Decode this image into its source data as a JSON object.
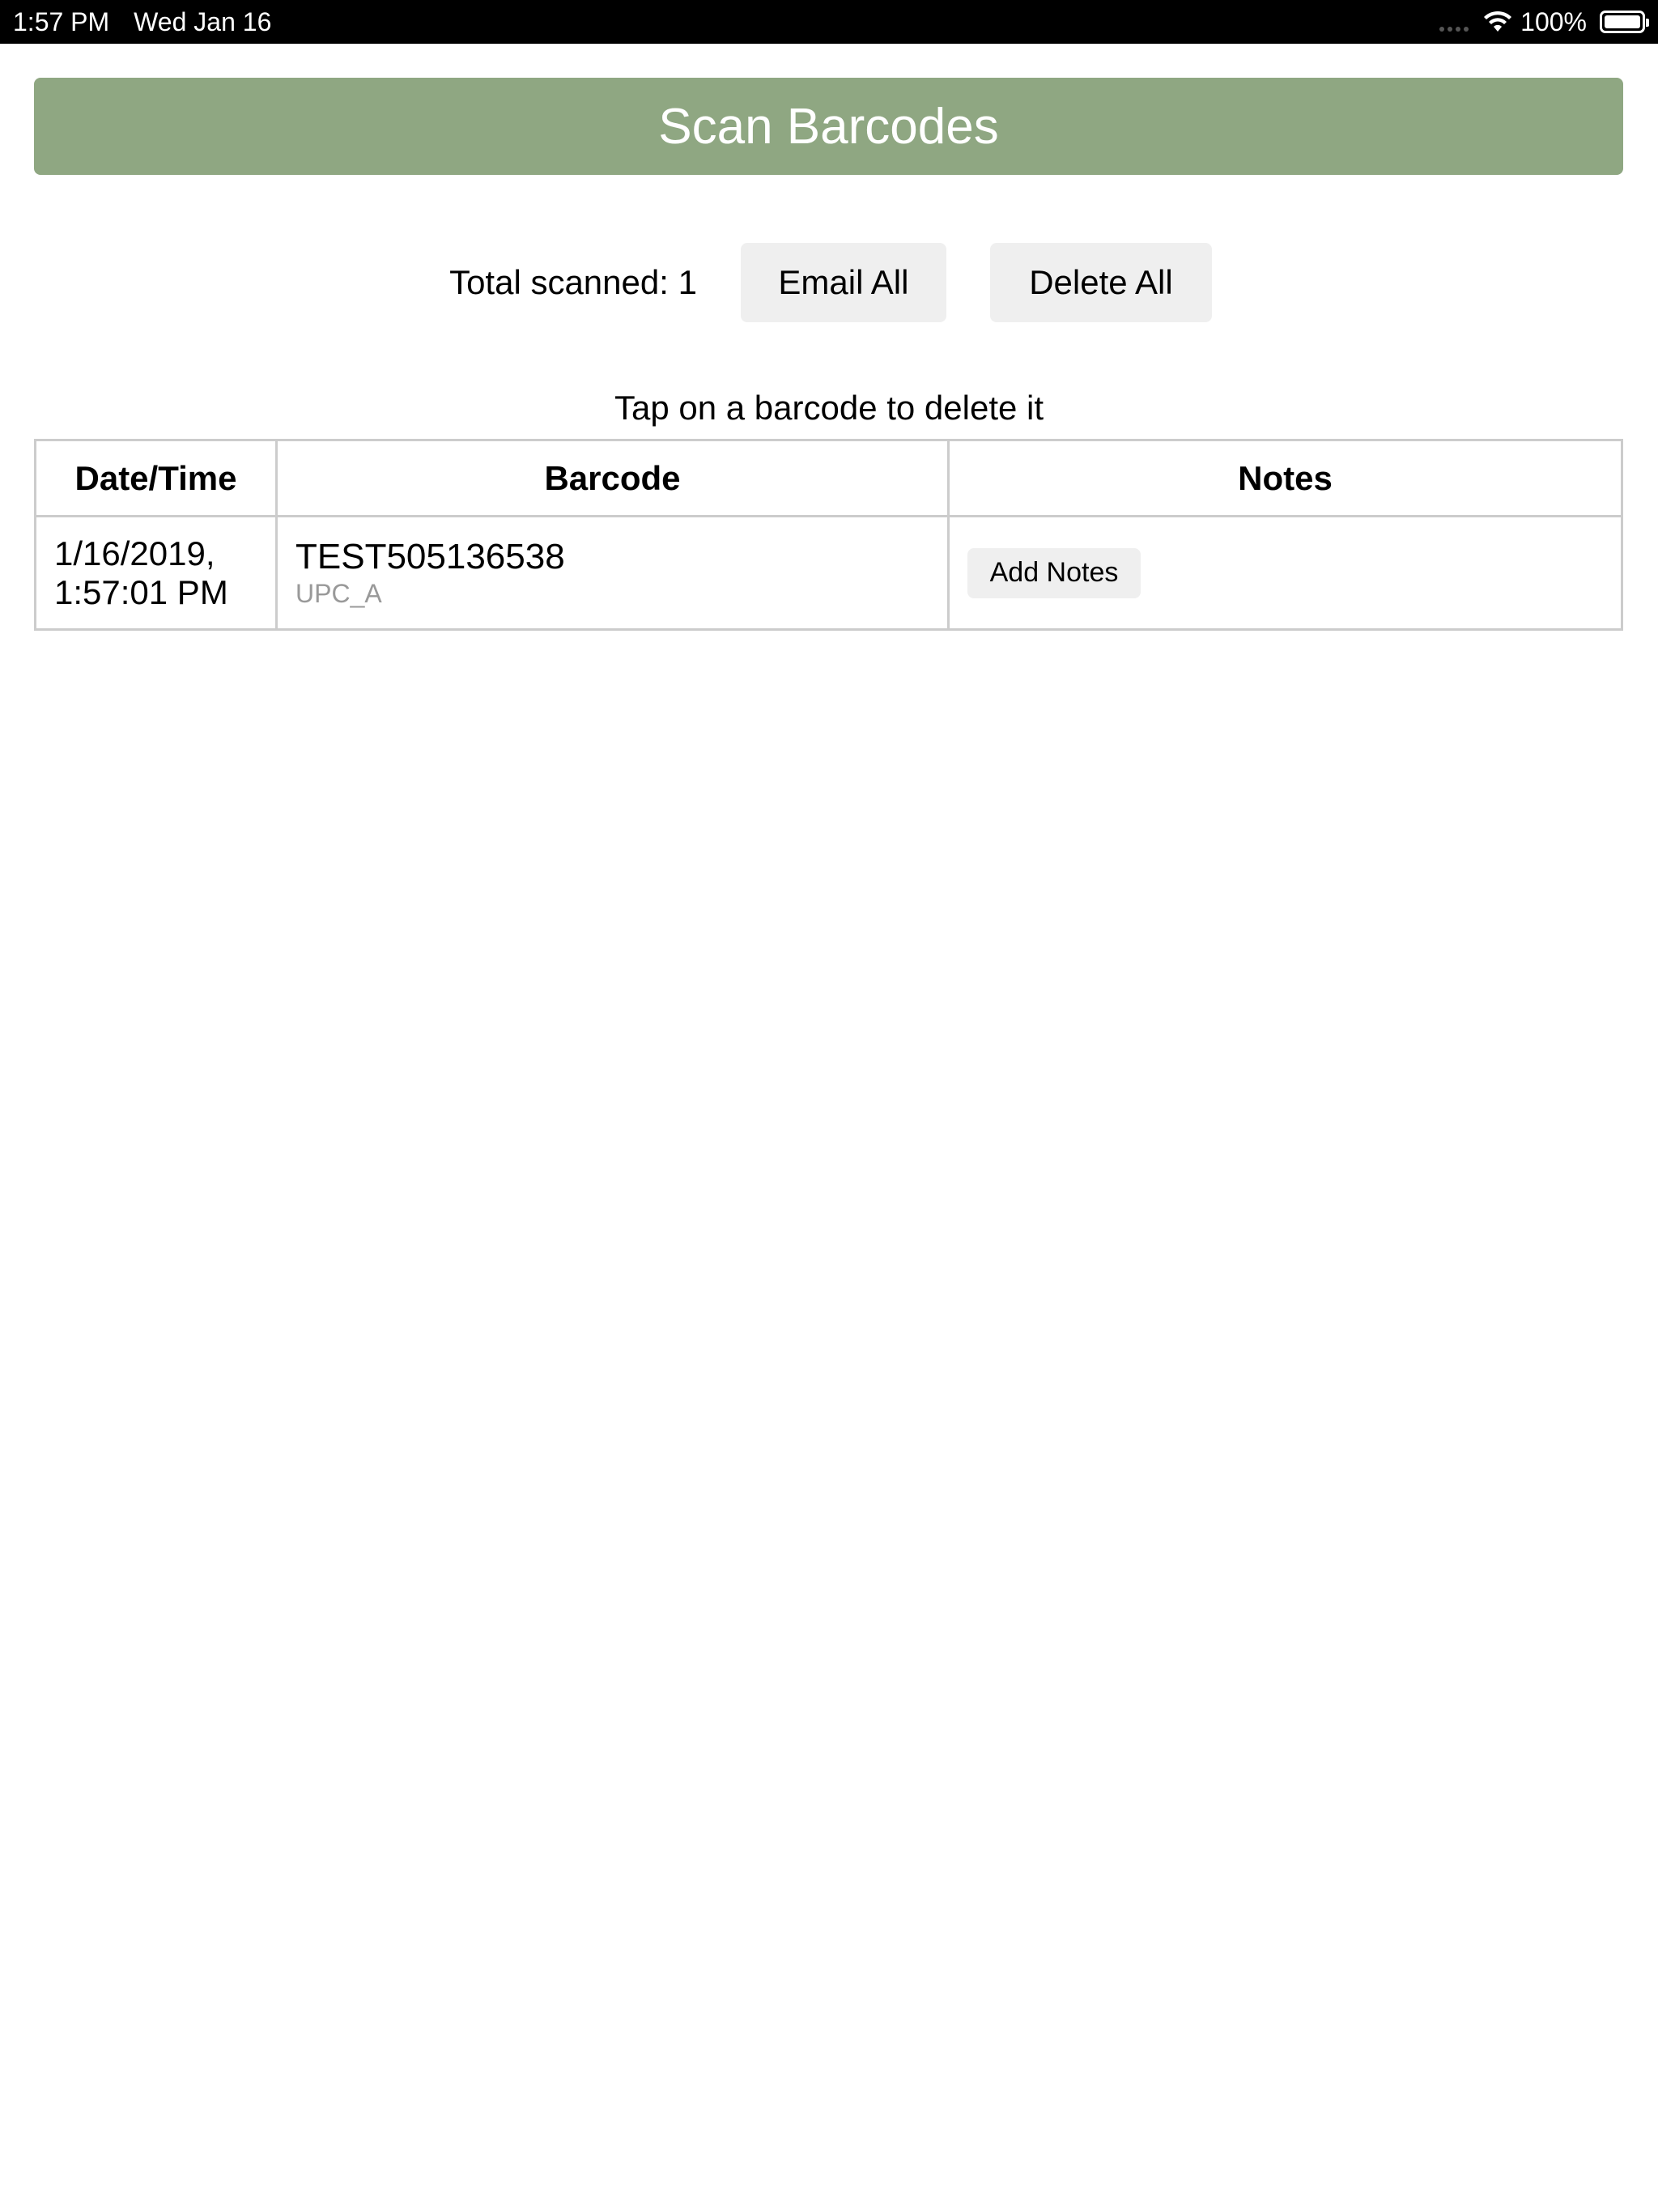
{
  "status_bar": {
    "time": "1:57 PM",
    "date": "Wed Jan 16",
    "battery_percent": "100%",
    "icons": [
      "signal-dots-icon",
      "wifi-icon",
      "battery-icon"
    ]
  },
  "header": {
    "title": "Scan Barcodes",
    "color": "#8fa782"
  },
  "controls": {
    "total_label": "Total scanned: 1",
    "email_all_label": "Email All",
    "delete_all_label": "Delete All"
  },
  "hint": "Tap on a barcode to delete it",
  "table": {
    "headers": [
      "Date/Time",
      "Barcode",
      "Notes"
    ],
    "rows": [
      {
        "date_line1": "1/16/2019,",
        "date_line2": "1:57:01 PM",
        "barcode": "TEST505136538",
        "type": "UPC_A",
        "notes_button": "Add Notes"
      }
    ]
  }
}
